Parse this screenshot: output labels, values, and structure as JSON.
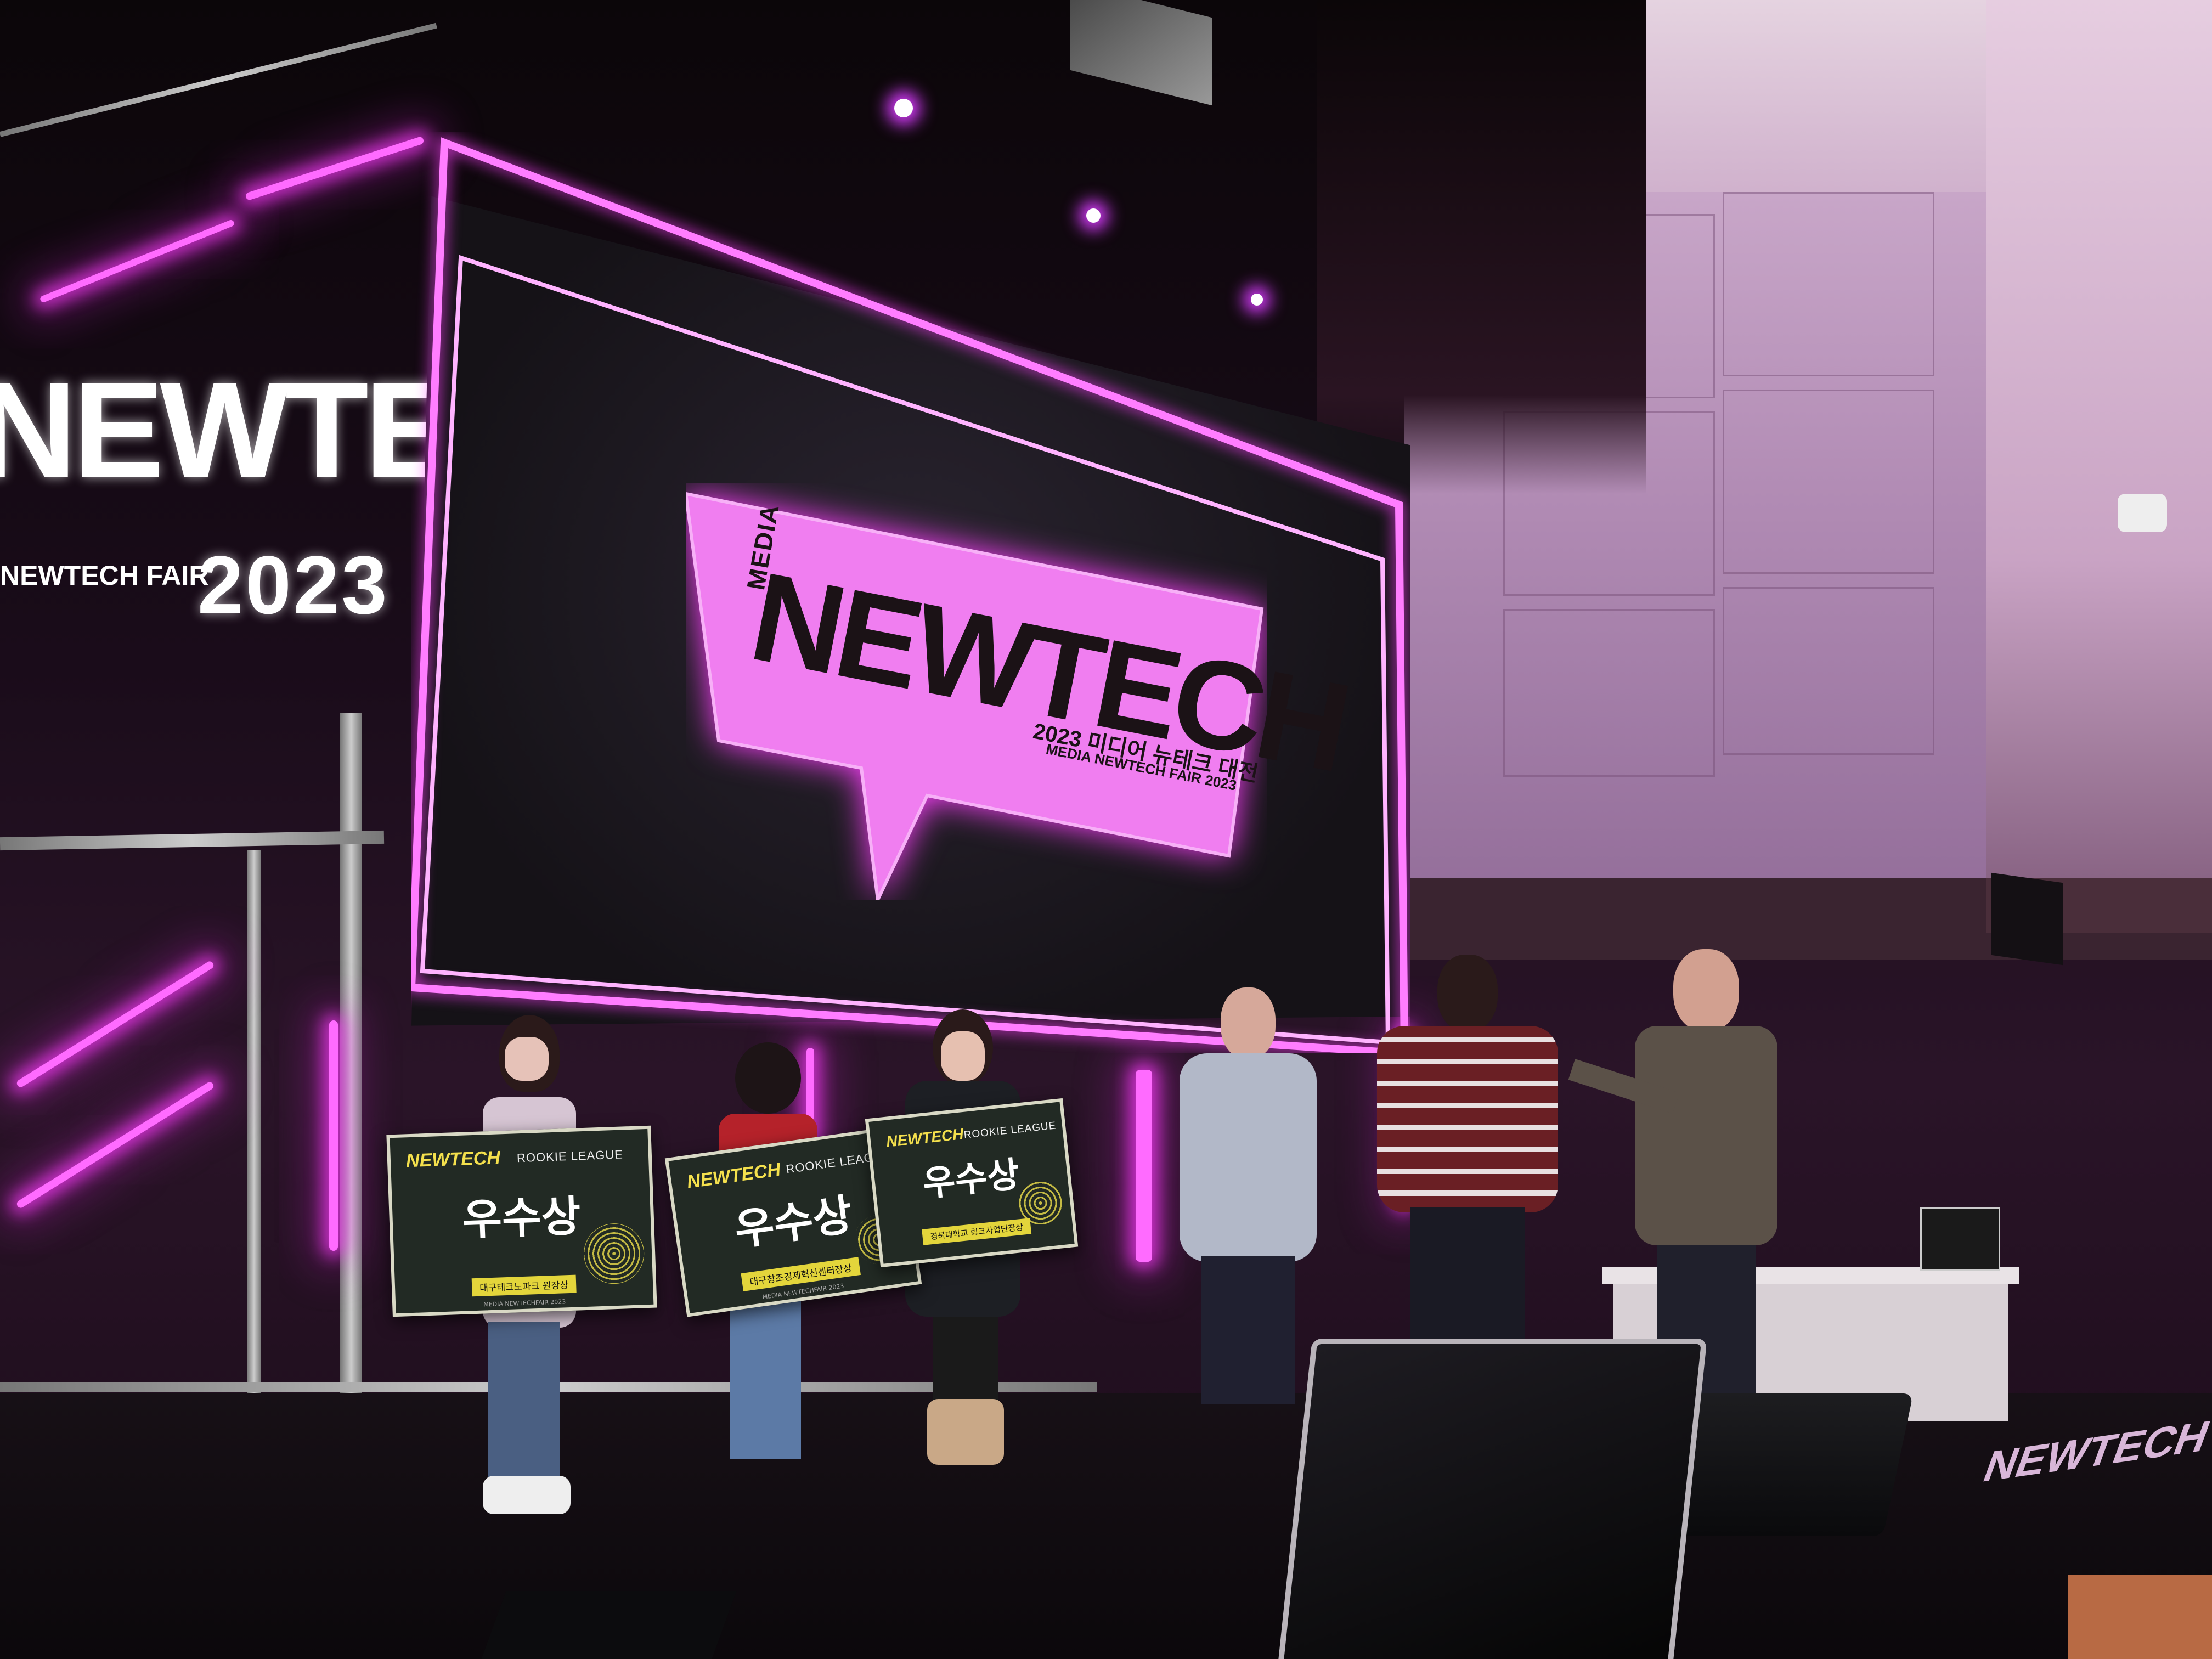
{
  "left_sign": {
    "logo_word": "NEWTECH",
    "fair_text": "NEWTECH FAIR",
    "year": "2023"
  },
  "screen": {
    "logo_small": "MEDIA",
    "logo_word": "NEWTECH",
    "korean_title": "2023 미디어 뉴테크 대전",
    "english_title": "MEDIA NEWTECH FAIR 2023"
  },
  "placards": [
    {
      "brand": "NEWTECH",
      "league": "ROOKIE LEAGUE",
      "award": "우수상",
      "subtitle": "대구테크노파크 원장상",
      "footer": "MEDIA NEWTECHFAIR 2023"
    },
    {
      "brand": "NEWTECH",
      "league": "ROOKIE LEAGUE",
      "award": "우수상",
      "subtitle": "대구창조경제혁신센터장상",
      "footer": "MEDIA NEWTECHFAIR 2023"
    },
    {
      "brand": "NEWTECH",
      "league": "ROOKIE LEAGUE",
      "award": "우수상",
      "subtitle": "경북대학교 링크사업단장상",
      "footer": ""
    }
  ],
  "stage_edge_text": "NEWTECH",
  "colors": {
    "neon_magenta": "#ff6bff",
    "screen_pink": "#f07ef0",
    "placard_yellow": "#e3d53b",
    "placard_green": "#222a24"
  },
  "icons": [
    "spotlight-icon",
    "security-camera-icon",
    "wall-speaker-icon",
    "spiral-graphic-icon"
  ]
}
